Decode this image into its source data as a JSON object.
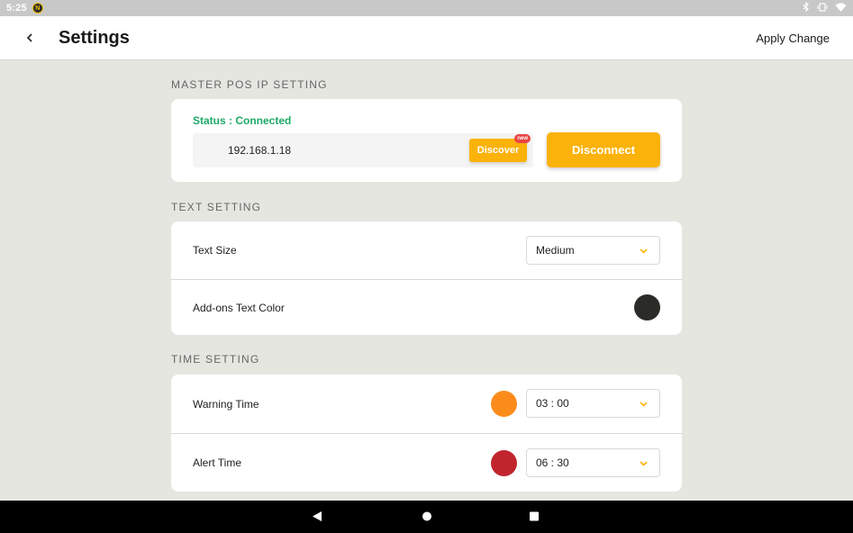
{
  "status_bar": {
    "time": "5:25",
    "badge": "N"
  },
  "header": {
    "title": "Settings",
    "apply_label": "Apply Change"
  },
  "master_pos": {
    "section_label": "MASTER POS IP SETTING",
    "status_text": "Status : Connected",
    "ip_value": "192.168.1.18",
    "discover_label": "Discover",
    "new_badge": "new",
    "disconnect_label": "Disconnect"
  },
  "text_setting": {
    "section_label": "TEXT SETTING",
    "text_size_label": "Text Size",
    "text_size_value": "Medium",
    "addons_color_label": "Add-ons Text Color",
    "addons_color": "#2b2b28"
  },
  "time_setting": {
    "section_label": "TIME SETTING",
    "warning_label": "Warning Time",
    "warning_value": "03 : 00",
    "warning_color": "#fb8c1c",
    "alert_label": "Alert Time",
    "alert_value": "06 : 30",
    "alert_color": "#c0252e"
  },
  "colors": {
    "accent": "#fbb20a",
    "connected": "#1fa968"
  }
}
